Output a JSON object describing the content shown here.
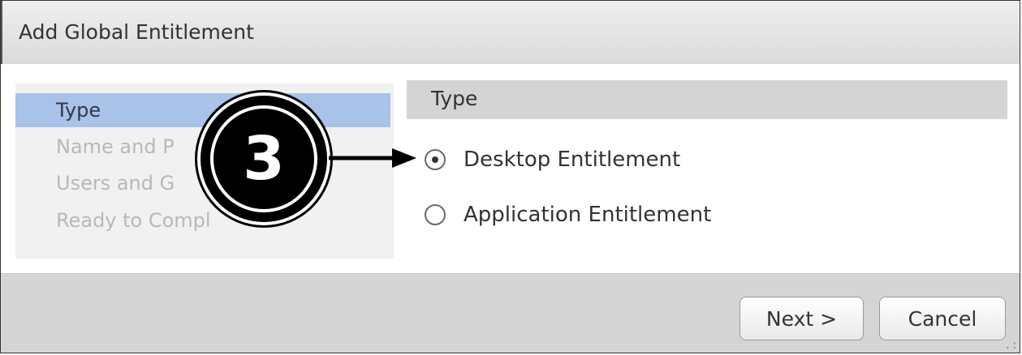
{
  "dialog": {
    "title": "Add Global Entitlement"
  },
  "wizard": {
    "steps": [
      {
        "label": "Type",
        "state": "active"
      },
      {
        "label": "Name and P",
        "state": "disabled"
      },
      {
        "label": "Users and G",
        "state": "disabled"
      },
      {
        "label": "Ready to Compl",
        "state": "disabled"
      }
    ]
  },
  "content": {
    "section_title": "Type",
    "options": [
      {
        "label": "Desktop Entitlement",
        "selected": true
      },
      {
        "label": "Application Entitlement",
        "selected": false
      }
    ]
  },
  "footer": {
    "next_label": "Next >",
    "cancel_label": "Cancel"
  },
  "callout": {
    "number": "3"
  },
  "colors": {
    "active_step": "#a9c2e8",
    "section_header": "#d4d4d4",
    "footer": "#d5d5d5"
  }
}
